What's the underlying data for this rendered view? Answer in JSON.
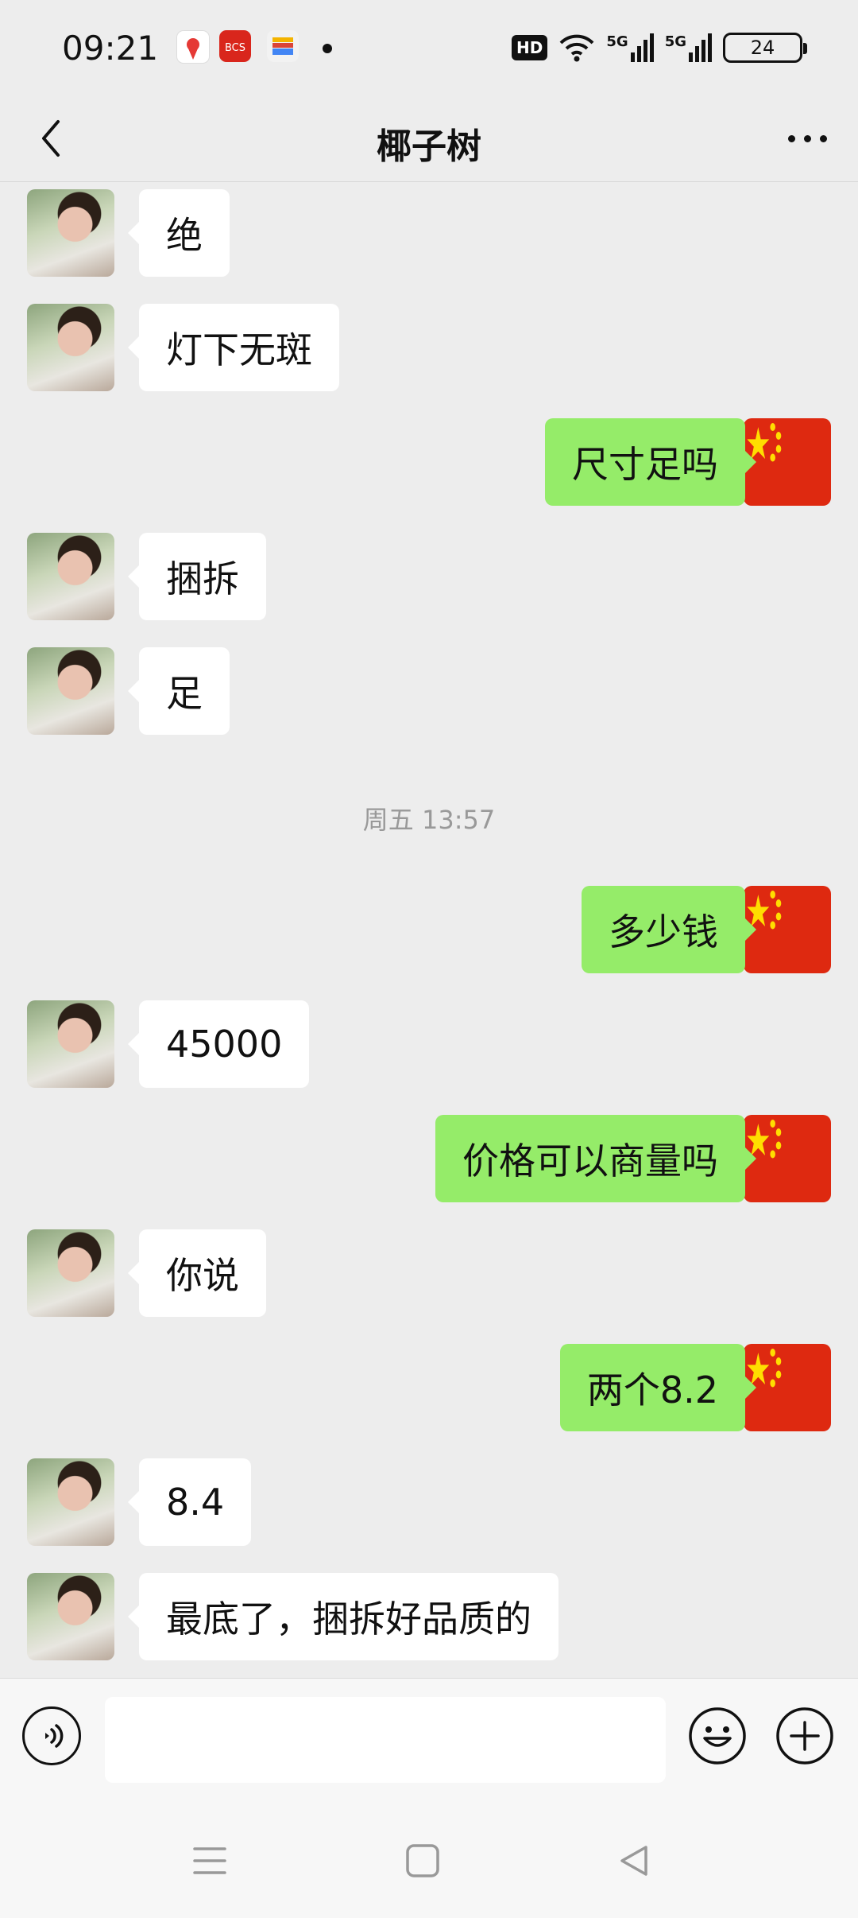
{
  "status_bar": {
    "time": "09:21",
    "hd_label": "HD",
    "network_1": "5G",
    "network_2": "5G",
    "battery": "24"
  },
  "nav": {
    "title": "椰子树"
  },
  "messages": [
    {
      "side": "left",
      "text": "绝"
    },
    {
      "side": "left",
      "text": "灯下无斑"
    },
    {
      "side": "right",
      "text": "尺寸足吗"
    },
    {
      "side": "left",
      "text": "捆拆"
    },
    {
      "side": "left",
      "text": "足"
    },
    {
      "side": "right",
      "text": "多少钱"
    },
    {
      "side": "left",
      "text": "45000"
    },
    {
      "side": "right",
      "text": "价格可以商量吗"
    },
    {
      "side": "left",
      "text": "你说"
    },
    {
      "side": "right",
      "text": "两个8.2"
    },
    {
      "side": "left",
      "text": "8.4"
    },
    {
      "side": "left",
      "text": "最底了，捆拆好品质的"
    }
  ],
  "timestamp": "周五 13:57",
  "input": {
    "value": "",
    "placeholder": ""
  },
  "icons": {
    "back": "chevron-left-icon",
    "more": "more-dots-icon",
    "voice": "voice-icon",
    "emoji": "emoji-icon",
    "plus": "plus-icon",
    "sys_menu": "menu-icon",
    "sys_home": "home-square-icon",
    "sys_back": "back-triangle-icon"
  },
  "colors": {
    "background": "#ededed",
    "sent_bubble": "#95ec69",
    "received_bubble": "#ffffff",
    "flag_red": "#de2910",
    "flag_yellow": "#ffde00"
  }
}
